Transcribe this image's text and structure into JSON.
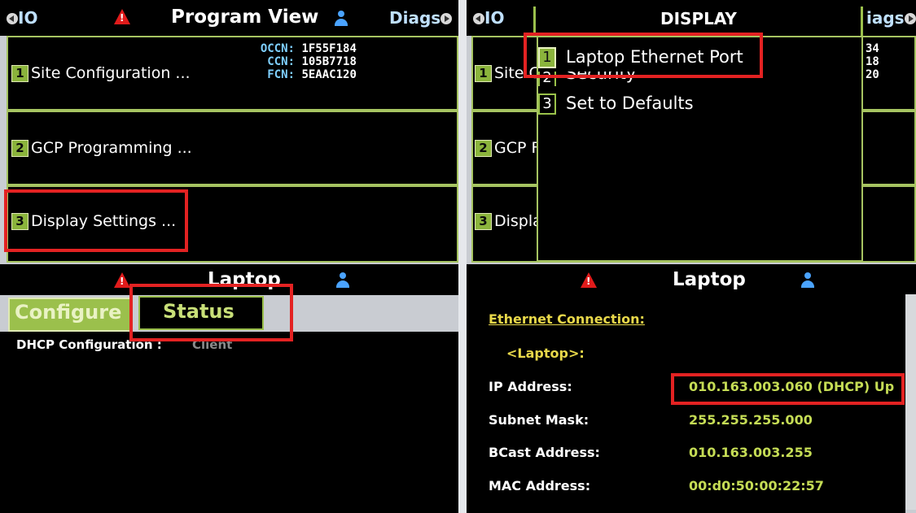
{
  "left": {
    "header": {
      "io_label": "IO",
      "title": "Program View",
      "diags_label": "Diags"
    },
    "rows": [
      {
        "num": "1",
        "label": "Site Configuration ..."
      },
      {
        "num": "2",
        "label": "GCP Programming ..."
      },
      {
        "num": "3",
        "label": "Display Settings ..."
      }
    ],
    "codes": [
      {
        "key": "OCCN:",
        "value": "1F55F184"
      },
      {
        "key": "CCN:",
        "value": "105B7718"
      },
      {
        "key": "FCN:",
        "value": "5EAAC120"
      }
    ],
    "laptop_title": "Laptop",
    "tabs": {
      "configure": "Configure",
      "status": "Status"
    },
    "dhcp_label": "DHCP Configuration :",
    "dhcp_value": "Client"
  },
  "right": {
    "header": {
      "io_label": "IO",
      "title": "DISPLAY",
      "diags_label": "iags"
    },
    "menu_items": [
      {
        "num": "1",
        "label": "Laptop Ethernet Port"
      },
      {
        "num": "2",
        "label": "Security"
      },
      {
        "num": "3",
        "label": "Set to Defaults"
      }
    ],
    "row_fragments": [
      "Site C",
      "GCP F",
      "Displa"
    ],
    "code_fragments": [
      "34",
      "18",
      "20"
    ],
    "laptop_title": "Laptop",
    "ethernet_heading": "Ethernet Connection:",
    "device": "<Laptop>:",
    "fields": [
      {
        "label": "IP Address:",
        "value": "010.163.003.060 (DHCP) Up"
      },
      {
        "label": "Subnet Mask:",
        "value": "255.255.255.000"
      },
      {
        "label": "BCast Address:",
        "value": "010.163.003.255"
      },
      {
        "label": "MAC Address:",
        "value": "00:d0:50:00:22:57"
      }
    ]
  },
  "colors": {
    "highlight": "#e32222",
    "accent": "#8bb43c",
    "value": "#c5dc55"
  },
  "icons": [
    "warning-icon",
    "user-icon",
    "arrow-left-icon",
    "arrow-right-icon"
  ]
}
